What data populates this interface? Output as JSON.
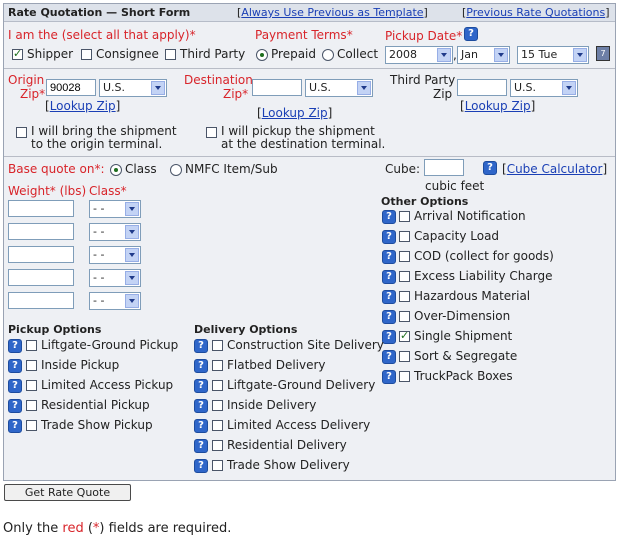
{
  "header": {
    "title": "Rate Quotation — Short Form",
    "link_template": "Always Use Previous as Template",
    "link_previous": "Previous Rate Quotations",
    "bracket_open": "[",
    "bracket_close": "]"
  },
  "iam": {
    "label": "I am the (select all that apply)*",
    "shipper": "Shipper",
    "consignee": "Consignee",
    "third_party": "Third Party",
    "shipper_checked": true,
    "consignee_checked": false,
    "third_party_checked": false
  },
  "payment": {
    "label": "Payment Terms*",
    "prepaid": "Prepaid",
    "collect": "Collect",
    "selected": "Prepaid"
  },
  "pickup_date": {
    "label": "Pickup Date*",
    "year": "2008",
    "month": "Jan",
    "day": "15 Tue",
    "comma": ","
  },
  "origin": {
    "label1": "Origin",
    "label2": "Zip*",
    "zip": "90028",
    "country": "U.S.",
    "lookup": "Lookup Zip",
    "bring_text1": "I will bring the shipment",
    "bring_text2": "to the origin terminal."
  },
  "destination": {
    "label1": "Destination",
    "label2": "Zip*",
    "zip": "",
    "country": "U.S.",
    "lookup": "Lookup Zip",
    "pickup_text1": "I will pickup the shipment",
    "pickup_text2": "at the destination terminal."
  },
  "third_party": {
    "label1": "Third Party",
    "label2": "Zip",
    "zip": "",
    "country": "U.S.",
    "lookup": "Lookup Zip"
  },
  "base_quote": {
    "label": "Base quote on*:",
    "class": "Class",
    "nmfc": "NMFC Item/Sub",
    "selected": "Class"
  },
  "cube": {
    "label": "Cube:",
    "value": "",
    "units": "cubic feet",
    "calculator": "Cube Calculator"
  },
  "items": {
    "weight_label": "Weight* (lbs)",
    "class_label": "Class*",
    "rows": [
      {
        "weight": "",
        "class": "- -"
      },
      {
        "weight": "",
        "class": "- -"
      },
      {
        "weight": "",
        "class": "- -"
      },
      {
        "weight": "",
        "class": "- -"
      },
      {
        "weight": "",
        "class": "- -"
      }
    ]
  },
  "other_options": {
    "title": "Other Options",
    "items": [
      {
        "label": "Arrival Notification",
        "checked": false
      },
      {
        "label": "Capacity Load",
        "checked": false
      },
      {
        "label": "COD (collect for goods)",
        "checked": false
      },
      {
        "label": "Excess Liability Charge",
        "checked": false
      },
      {
        "label": "Hazardous Material",
        "checked": false
      },
      {
        "label": "Over-Dimension",
        "checked": false
      },
      {
        "label": "Single Shipment",
        "checked": true
      },
      {
        "label": "Sort & Segregate",
        "checked": false
      },
      {
        "label": "TruckPack Boxes",
        "checked": false
      }
    ]
  },
  "pickup_options": {
    "title": "Pickup Options",
    "items": [
      {
        "label": "Liftgate-Ground Pickup",
        "checked": false
      },
      {
        "label": "Inside Pickup",
        "checked": false
      },
      {
        "label": "Limited Access Pickup",
        "checked": false
      },
      {
        "label": "Residential Pickup",
        "checked": false
      },
      {
        "label": "Trade Show Pickup",
        "checked": false
      }
    ]
  },
  "delivery_options": {
    "title": "Delivery Options",
    "items": [
      {
        "label": "Construction Site Delivery",
        "checked": false
      },
      {
        "label": "Flatbed Delivery",
        "checked": false
      },
      {
        "label": "Liftgate-Ground Delivery",
        "checked": false
      },
      {
        "label": "Inside Delivery",
        "checked": false
      },
      {
        "label": "Limited Access Delivery",
        "checked": false
      },
      {
        "label": "Residential Delivery",
        "checked": false
      },
      {
        "label": "Trade Show Delivery",
        "checked": false
      }
    ]
  },
  "actions": {
    "get_quote": "Get Rate Quote"
  },
  "footer": {
    "prefix": "Only the ",
    "red_word": "red",
    "open_paren": " (",
    "asterisk": "*",
    "suffix": ") fields are required."
  },
  "icons": {
    "help": "help-icon",
    "calendar": "calendar-icon",
    "dropdown": "chevron-down-icon"
  },
  "colors": {
    "required": "#d8242a",
    "link": "#1a3fb5",
    "panel_bg": "#eef0f4",
    "help_icon": "#2f66c9"
  }
}
